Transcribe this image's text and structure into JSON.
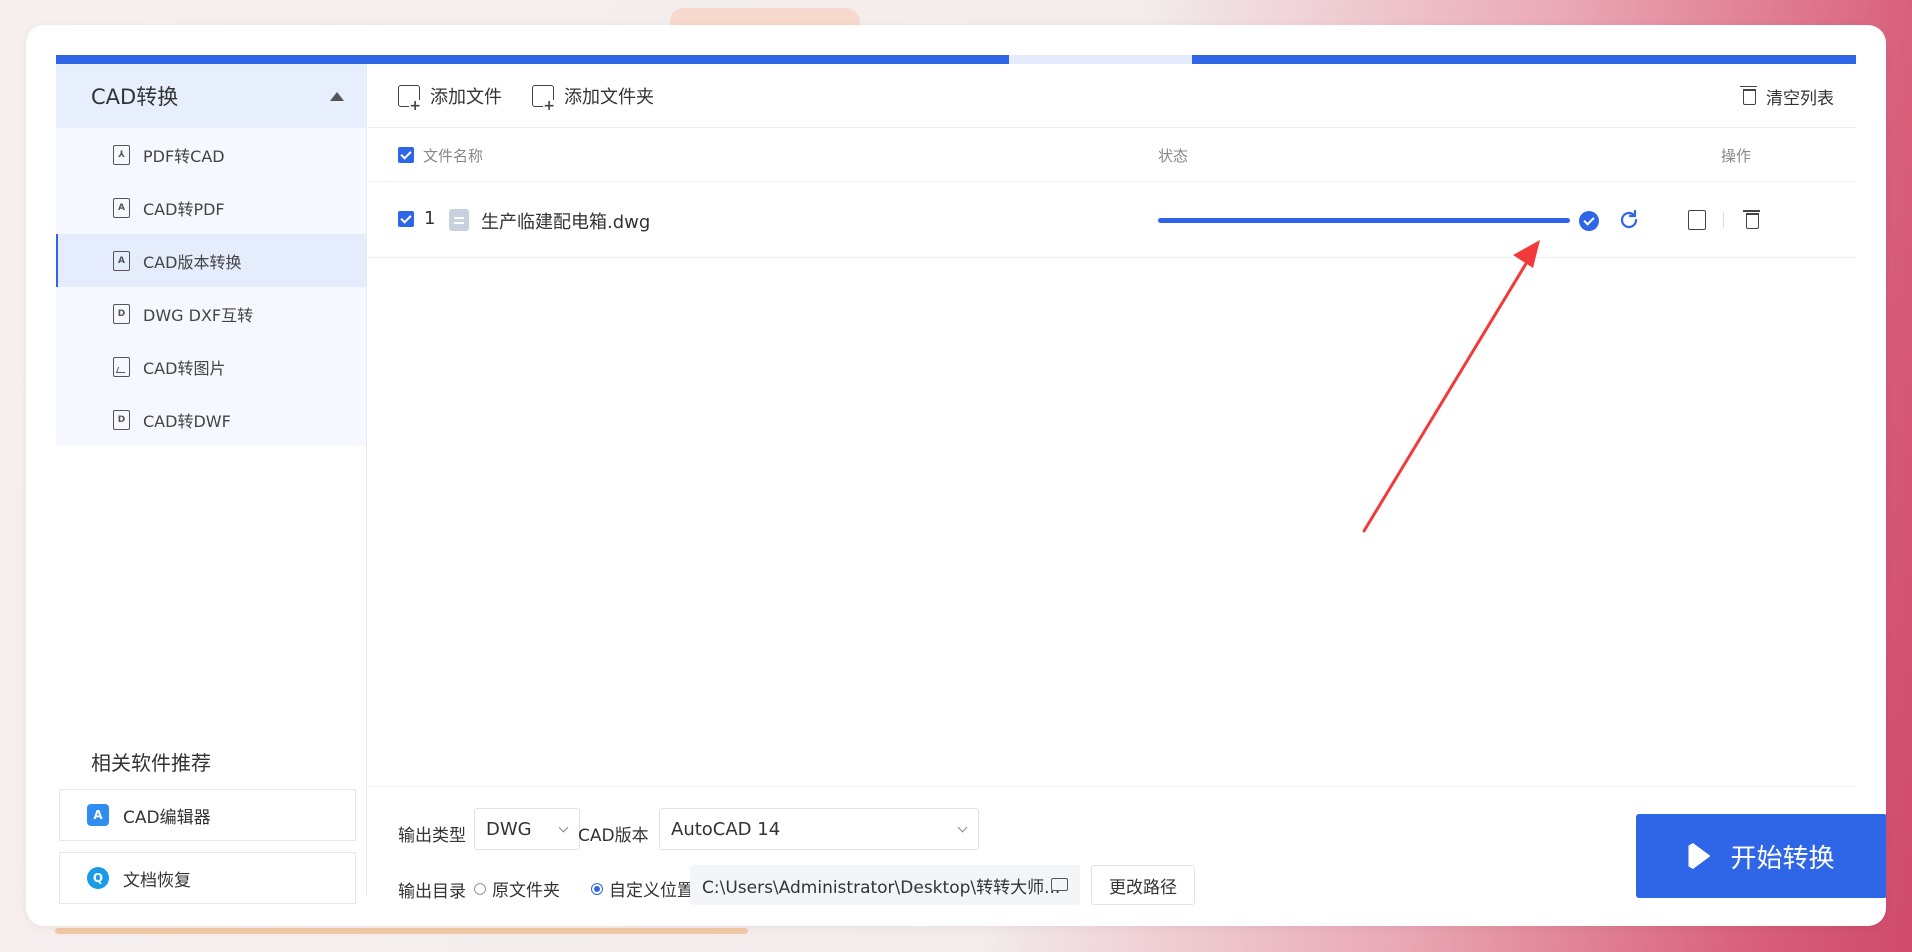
{
  "sidebar": {
    "header": "CAD转换",
    "items": [
      {
        "label": "PDF转CAD",
        "icon": "pdf-icon"
      },
      {
        "label": "CAD转PDF",
        "icon": "cad-file-icon"
      },
      {
        "label": "CAD版本转换",
        "icon": "cad-file-icon"
      },
      {
        "label": "DWG DXF互转",
        "icon": "dwg-file-icon"
      },
      {
        "label": "CAD转图片",
        "icon": "image-icon"
      },
      {
        "label": "CAD转DWF",
        "icon": "dwg-file-icon"
      }
    ],
    "active_index": 2,
    "recommend_title": "相关软件推荐",
    "recommend": [
      {
        "label": "CAD编辑器",
        "icon": "cad-editor-logo",
        "color": "#2f8cf0"
      },
      {
        "label": "文档恢复",
        "icon": "doc-recovery-logo",
        "color": "#1a9be8"
      }
    ]
  },
  "toolbar": {
    "add_file": "添加文件",
    "add_folder": "添加文件夹",
    "clear_list": "清空列表"
  },
  "table": {
    "col_name": "文件名称",
    "col_status": "状态",
    "col_action": "操作",
    "rows": [
      {
        "index": "1",
        "filename": "生产临建配电箱.dwg",
        "progress": 100,
        "checked": true
      }
    ]
  },
  "bottom": {
    "output_type_label": "输出类型",
    "output_type_value": "DWG",
    "cad_version_label": "CAD版本",
    "cad_version_value": "AutoCAD 14",
    "output_dir_label": "输出目录",
    "radio_original": "原文件夹",
    "radio_custom": "自定义位置",
    "path_value": "C:\\Users\\Administrator\\Desktop\\转转大师...",
    "change_path": "更改路径",
    "start_button": "开始转换"
  },
  "colors": {
    "accent": "#2f66e8",
    "annotation_arrow": "#f23a3a"
  }
}
